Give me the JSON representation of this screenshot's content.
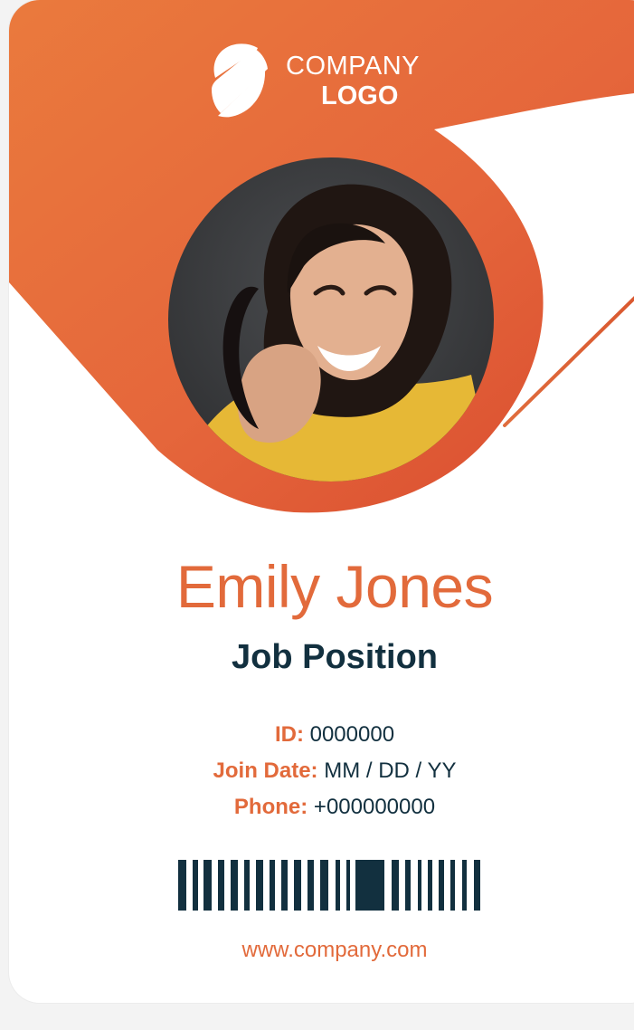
{
  "company": {
    "line1": "COMPANY",
    "line2": "LOGO"
  },
  "person": {
    "name": "Emily Jones",
    "title": "Job Position"
  },
  "details": {
    "id_label": "ID:",
    "id_value": "0000000",
    "join_label": "Join Date:",
    "join_value": "MM / DD / YY",
    "phone_label": "Phone:",
    "phone_value": "+000000000"
  },
  "website": "www.company.com",
  "colors": {
    "accent": "#e26a3b",
    "accent_dark": "#d44a2d",
    "text_dark": "#12303f",
    "background": "#ffffff"
  },
  "icons": {
    "logo_mark": "split-circle-logo-icon",
    "barcode": "barcode-icon",
    "profile": "profile-photo"
  }
}
